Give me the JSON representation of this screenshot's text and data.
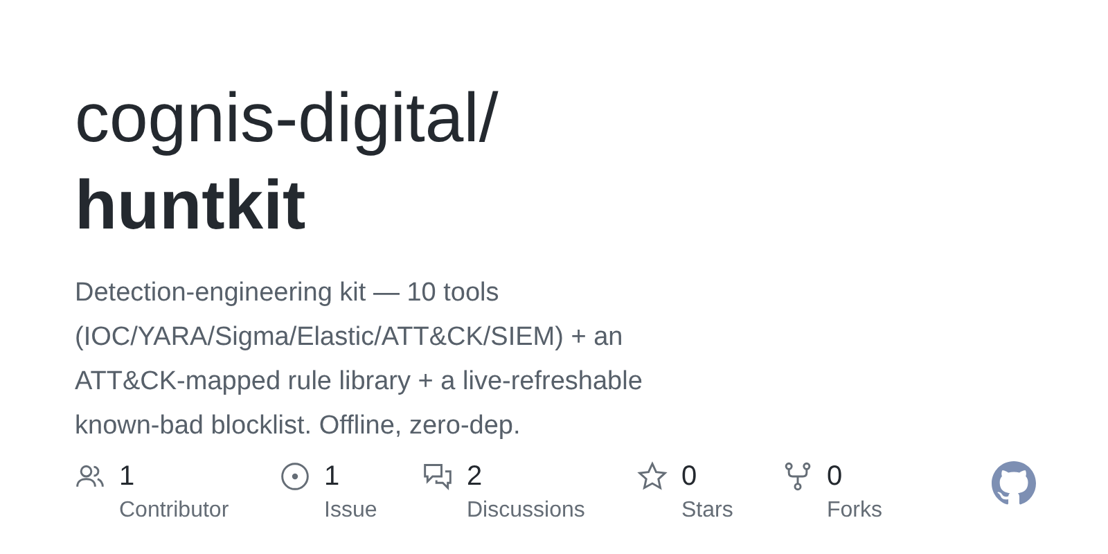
{
  "owner": "cognis-digital/",
  "repo": "huntkit",
  "description": "Detection-engineering kit — 10 tools\n(IOC/YARA/Sigma/Elastic/ATT&CK/SIEM) + an\nATT&CK-mapped rule library + a live-refreshable\nknown-bad blocklist. Offline, zero-dep.",
  "stats": [
    {
      "kind": "contributors",
      "count": "1",
      "label": "Contributor"
    },
    {
      "kind": "issues",
      "count": "1",
      "label": "Issue"
    },
    {
      "kind": "discussions",
      "count": "2",
      "label": "Discussions"
    },
    {
      "kind": "stars",
      "count": "0",
      "label": "Stars"
    },
    {
      "kind": "forks",
      "count": "0",
      "label": "Forks"
    }
  ]
}
